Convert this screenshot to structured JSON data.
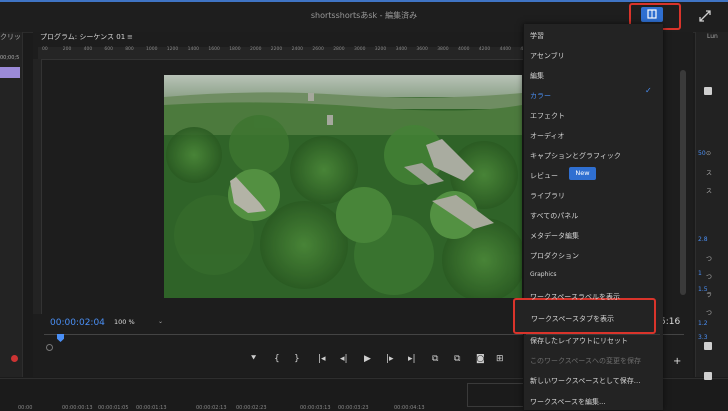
{
  "app": {
    "title": "shortsshortsあsk - 編集済み",
    "accent_color": "#2f6fd1",
    "highlight_color": "#d9342b"
  },
  "left_panel": {
    "tab_label": "クリッ",
    "time_snippet": "00;00;5"
  },
  "monitor": {
    "title": "プログラム: シーケンス 01",
    "menu_icon": "hamburger-icon",
    "timecode": "00:00:02:04",
    "zoom": "100 %",
    "end_time": "5:16",
    "ruler_labels": [
      "00",
      "200",
      "400",
      "600",
      "800",
      "1000",
      "1200",
      "1400",
      "1600",
      "1800",
      "2000",
      "2200",
      "2400",
      "2600",
      "2800",
      "3000",
      "3200",
      "3400",
      "3600",
      "3800",
      "4000",
      "4200",
      "4400",
      "4600"
    ]
  },
  "transport": {
    "icons": [
      "marker-icon",
      "in-point-icon",
      "out-point-icon",
      "go-to-in-icon",
      "step-back-icon",
      "play-icon",
      "step-forward-icon",
      "go-to-out-icon",
      "lift-icon",
      "extract-icon",
      "export-frame-icon",
      "comparison-icon"
    ],
    "glyphs": [
      "⯆",
      "{",
      "}",
      "|◂",
      "◂|",
      "▶",
      "|▸",
      "▸|",
      "⧉",
      "⧉",
      "◙",
      "⊞"
    ],
    "plus": "+"
  },
  "timeline": {
    "labels": [
      "00:00",
      "00:00:00:13",
      "00:00:01:05",
      "00:00:01:13",
      "00:00:02:13",
      "00:00:02:23",
      "00:00:03:13",
      "00:00:03:23",
      "00:00:04:13"
    ]
  },
  "right_panel": {
    "title": "Lun",
    "blue_labels": [
      "50",
      "2.8",
      "1",
      "1.5",
      "1.2",
      "3.3"
    ],
    "glyphs": [
      "⊙",
      "ス",
      "ス",
      "つ",
      "つ",
      "ラ",
      "つ"
    ]
  },
  "menu": {
    "items": [
      {
        "label": "学習",
        "state": "normal"
      },
      {
        "label": "アセンブリ",
        "state": "normal"
      },
      {
        "label": "編集",
        "state": "normal"
      },
      {
        "label": "カラー",
        "state": "selected"
      },
      {
        "label": "エフェクト",
        "state": "normal"
      },
      {
        "label": "オーディオ",
        "state": "normal"
      },
      {
        "label": "キャプションとグラフィック",
        "state": "normal"
      },
      {
        "label": "レビュー",
        "state": "normal"
      },
      {
        "label": "ライブラリ",
        "state": "normal"
      },
      {
        "label": "すべてのパネル",
        "state": "normal"
      },
      {
        "label": "メタデータ編集",
        "state": "normal"
      },
      {
        "label": "プロダクション",
        "state": "normal"
      },
      {
        "label": "Graphics",
        "state": "normal"
      },
      {
        "label": "ワークスペースラベルを表示",
        "state": "normal"
      },
      {
        "label": "ワークスペースタブを表示",
        "state": "highlighted"
      },
      {
        "label": "保存したレイアウトにリセット",
        "state": "normal"
      },
      {
        "label": "このワークスペースへの変更を保存",
        "state": "disabled"
      },
      {
        "label": "新しいワークスペースとして保存...",
        "state": "normal"
      },
      {
        "label": "ワークスペースを編集...",
        "state": "normal"
      }
    ],
    "new_badge": "New",
    "check_icon": "✓"
  }
}
